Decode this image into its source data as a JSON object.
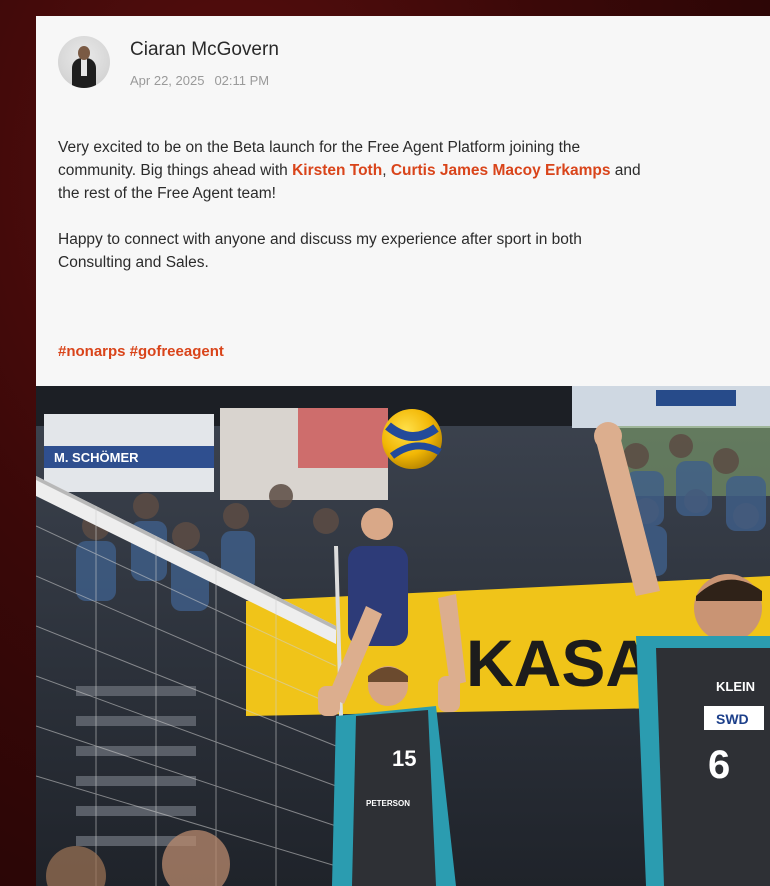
{
  "post": {
    "author_name": "Ciaran McGovern",
    "date": "Apr 22, 2025",
    "time": "02:11 PM",
    "paragraph1_start": "Very excited to be on the Beta launch for the Free Agent Platform  joining the",
    "paragraph1_line2_start": "community. Big things ahead with ",
    "mention1": "Kirsten Toth",
    "comma": ", ",
    "mention2": "Curtis James Macoy Erkamps",
    "paragraph1_line2_end": " and",
    "paragraph1_line3": "the rest of the Free Agent team!",
    "paragraph2_line1": "Happy to connect with anyone and discuss my experience after sport in both",
    "paragraph2_line2": "Consulting and Sales.",
    "hashtags": "#nonarps #gofreeagent"
  },
  "photo": {
    "banner_text": "M. SCHÖMER",
    "ad_text": "KASA",
    "jersey_left_number": "15",
    "jersey_right_number": "6",
    "jersey_right_name": "KLEIN",
    "sponsor": "SWD",
    "sponsor_left": "PETERSON"
  },
  "colors": {
    "accent": "#d9441a",
    "card": "#f7f7f7",
    "backdrop": "#3a0808"
  },
  "icons": {
    "avatar": "profile-photo"
  }
}
